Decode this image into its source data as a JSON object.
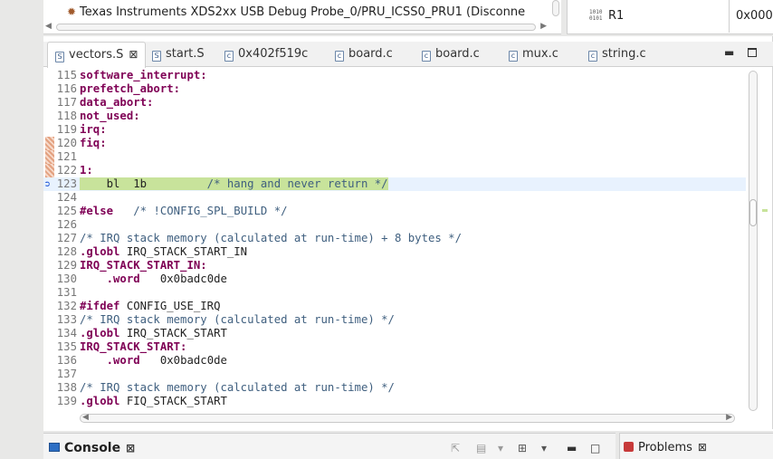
{
  "debug_view": {
    "target_label": "Texas Instruments XDS2xx USB Debug Probe_0/PRU_ICSS0_PRU1 (Disconne",
    "icon": "bug-icon"
  },
  "registers_view": {
    "register_name": "R1",
    "register_value": "0x000",
    "icon": "register-icon"
  },
  "editor": {
    "tabs": [
      {
        "label": "vectors.S",
        "icon": "S",
        "active": true,
        "closable": true
      },
      {
        "label": "start.S",
        "icon": "S",
        "active": false,
        "closable": false
      },
      {
        "label": "0x402f519c",
        "icon": "c",
        "active": false,
        "closable": false
      },
      {
        "label": "board.c",
        "icon": "c",
        "active": false,
        "closable": false
      },
      {
        "label": "board.c",
        "icon": "c",
        "active": false,
        "closable": false
      },
      {
        "label": "mux.c",
        "icon": "c",
        "active": false,
        "closable": false
      },
      {
        "label": "string.c",
        "icon": "c",
        "active": false,
        "closable": false
      }
    ],
    "close_glyph": "⊠",
    "lines": [
      {
        "num": "115",
        "parts": [
          {
            "t": "software_interrupt:",
            "c": "kw"
          }
        ]
      },
      {
        "num": "116",
        "parts": [
          {
            "t": "prefetch_abort:",
            "c": "kw"
          }
        ]
      },
      {
        "num": "117",
        "parts": [
          {
            "t": "data_abort:",
            "c": "kw"
          }
        ]
      },
      {
        "num": "118",
        "parts": [
          {
            "t": "not_used:",
            "c": "kw"
          }
        ]
      },
      {
        "num": "119",
        "parts": [
          {
            "t": "irq:",
            "c": "kw"
          }
        ]
      },
      {
        "num": "120",
        "parts": [
          {
            "t": "fiq:",
            "c": "kw"
          }
        ]
      },
      {
        "num": "121",
        "parts": []
      },
      {
        "num": "122",
        "parts": [
          {
            "t": "1:",
            "c": "kw"
          }
        ]
      },
      {
        "num": "123",
        "parts": [
          {
            "t": "    bl  1b         /* hang and never return */",
            "c": "hl"
          }
        ]
      },
      {
        "num": "124",
        "parts": []
      },
      {
        "num": "125",
        "parts": [
          {
            "t": "#else",
            "c": "kw"
          },
          {
            "t": "   /* !CONFIG_SPL_BUILD */",
            "c": "cm"
          }
        ]
      },
      {
        "num": "126",
        "parts": []
      },
      {
        "num": "127",
        "parts": [
          {
            "t": "/* IRQ stack memory (calculated at run-time) + 8 bytes */",
            "c": "cm"
          }
        ]
      },
      {
        "num": "128",
        "parts": [
          {
            "t": ".globl",
            "c": "kw"
          },
          {
            "t": " IRQ_STACK_START_IN",
            "c": ""
          }
        ]
      },
      {
        "num": "129",
        "parts": [
          {
            "t": "IRQ_STACK_START_IN:",
            "c": "kw"
          }
        ]
      },
      {
        "num": "130",
        "parts": [
          {
            "t": "    ",
            "c": ""
          },
          {
            "t": ".word",
            "c": "kw"
          },
          {
            "t": "   0x0badc0de",
            "c": ""
          }
        ]
      },
      {
        "num": "131",
        "parts": []
      },
      {
        "num": "132",
        "parts": [
          {
            "t": "#ifdef",
            "c": "kw"
          },
          {
            "t": " CONFIG_USE_IRQ",
            "c": ""
          }
        ]
      },
      {
        "num": "133",
        "parts": [
          {
            "t": "/* IRQ stack memory (calculated at run-time) */",
            "c": "cm"
          }
        ]
      },
      {
        "num": "134",
        "parts": [
          {
            "t": ".globl",
            "c": "kw"
          },
          {
            "t": " IRQ_STACK_START",
            "c": ""
          }
        ]
      },
      {
        "num": "135",
        "parts": [
          {
            "t": "IRQ_STACK_START:",
            "c": "kw"
          }
        ]
      },
      {
        "num": "136",
        "parts": [
          {
            "t": "    ",
            "c": ""
          },
          {
            "t": ".word",
            "c": "kw"
          },
          {
            "t": "   0x0badc0de",
            "c": ""
          }
        ]
      },
      {
        "num": "137",
        "parts": []
      },
      {
        "num": "138",
        "parts": [
          {
            "t": "/* IRQ stack memory (calculated at run-time) */",
            "c": "cm"
          }
        ]
      },
      {
        "num": "139",
        "parts": [
          {
            "t": ".globl",
            "c": "kw"
          },
          {
            "t": " FIQ_STACK_START",
            "c": ""
          }
        ]
      }
    ],
    "marked_lines": [
      "120",
      "121",
      "122"
    ],
    "current_line": "123",
    "colors": {
      "keyword": "#7f0055",
      "comment": "#3f5f7f",
      "current_line_bg": "#e8f2fe",
      "highlight_bg": "#c8e39b"
    }
  },
  "bottom_panel": {
    "console_label": "Console",
    "problems_label": "Problems",
    "close_glyph": "⊠"
  }
}
